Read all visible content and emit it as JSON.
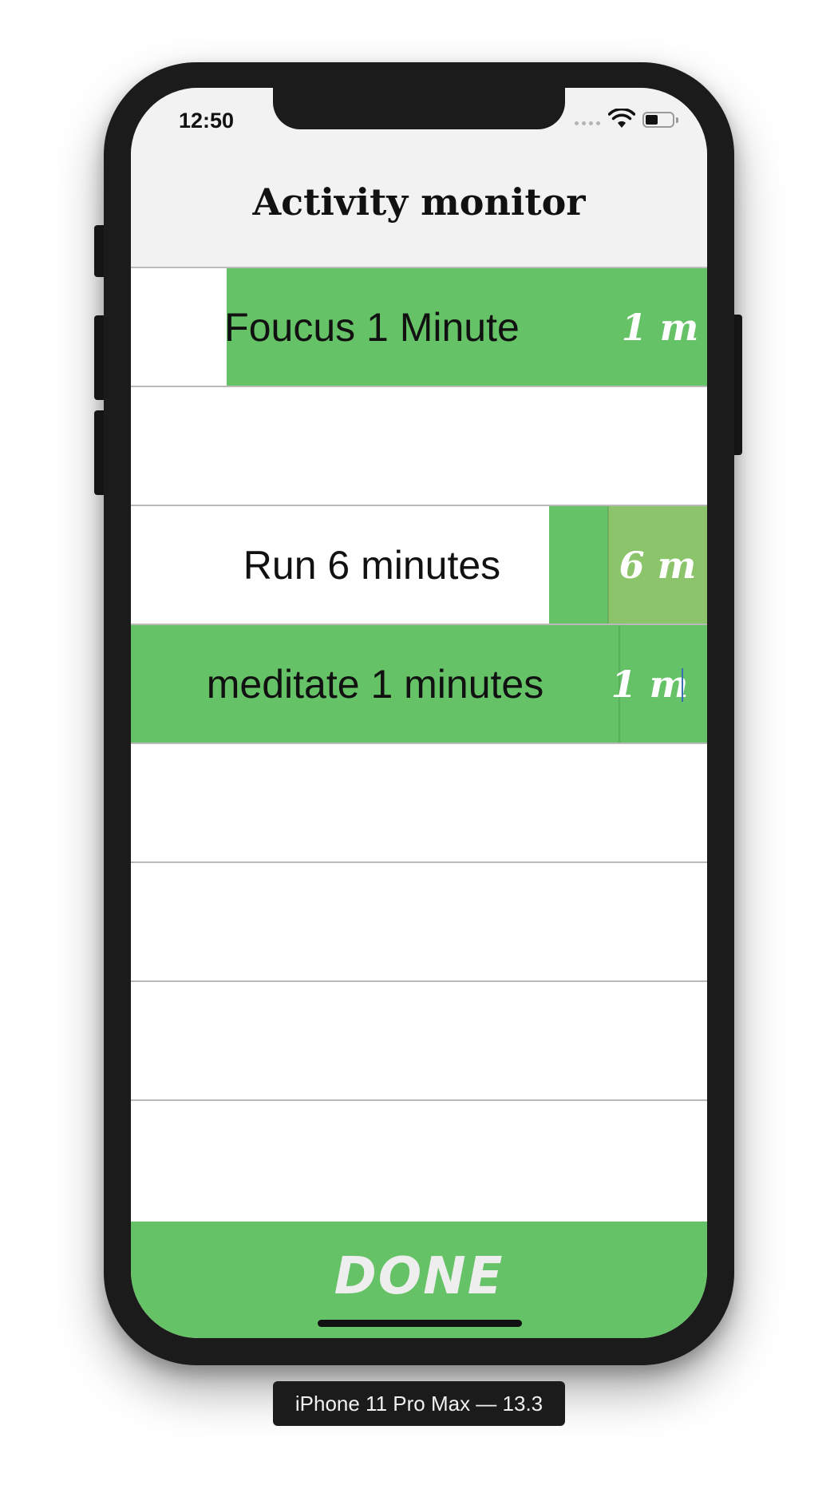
{
  "status_bar": {
    "time": "12:50",
    "icons": [
      "cellular-signal-icon",
      "wifi-icon",
      "battery-icon"
    ]
  },
  "header": {
    "title": "Activity monitor"
  },
  "activities": [
    {
      "label": "Foucus 1 Minute",
      "duration": "1 m",
      "progress": 0.84
    },
    {
      "label": "",
      "duration": "",
      "progress": 0
    },
    {
      "label": "Run 6 minutes",
      "duration": "6 m",
      "progress": 0.27
    },
    {
      "label": "meditate 1 minutes",
      "duration": "1 m",
      "progress": 1.0
    },
    {
      "label": "",
      "duration": "",
      "progress": 0
    },
    {
      "label": "",
      "duration": "",
      "progress": 0
    },
    {
      "label": "",
      "duration": "",
      "progress": 0
    },
    {
      "label": "",
      "duration": "",
      "progress": 0
    }
  ],
  "done_button": {
    "label": "DONE"
  },
  "device_caption": "iPhone 11 Pro Max — 13.3",
  "colors": {
    "accent_green": "#66c266",
    "duration_green": "#8bc46b",
    "header_bg": "#f2f2f2",
    "done_text": "#eeeeee",
    "device_frame": "#1b1b1b"
  }
}
